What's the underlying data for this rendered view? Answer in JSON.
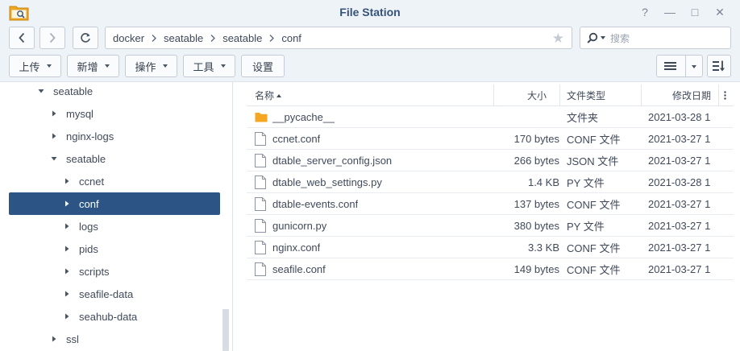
{
  "window": {
    "title": "File Station",
    "help": "?",
    "minimize": "—",
    "maximize": "□",
    "close": "✕"
  },
  "nav": {
    "breadcrumbs": [
      "docker",
      "seatable",
      "seatable",
      "conf"
    ],
    "search_placeholder": "搜索"
  },
  "toolbar": {
    "upload": "上传",
    "create": "新增",
    "action": "操作",
    "tools": "工具",
    "settings": "设置"
  },
  "sidebar": {
    "items": [
      {
        "label": "seatable",
        "expanded": true
      },
      {
        "label": "mysql",
        "expanded": false
      },
      {
        "label": "nginx-logs",
        "expanded": false
      },
      {
        "label": "seatable",
        "expanded": true
      },
      {
        "label": "ccnet",
        "expanded": false
      },
      {
        "label": "conf",
        "expanded": false,
        "selected": true
      },
      {
        "label": "logs",
        "expanded": false
      },
      {
        "label": "pids",
        "expanded": false
      },
      {
        "label": "scripts",
        "expanded": false
      },
      {
        "label": "seafile-data",
        "expanded": false
      },
      {
        "label": "seahub-data",
        "expanded": false
      },
      {
        "label": "ssl",
        "expanded": false
      }
    ]
  },
  "file_list": {
    "columns": {
      "name": "名称",
      "size": "大小",
      "type": "文件类型",
      "modified": "修改日期"
    },
    "rows": [
      {
        "name": "__pycache__",
        "size": "",
        "type": "文件夹",
        "modified": "2021-03-28 1",
        "kind": "folder"
      },
      {
        "name": "ccnet.conf",
        "size": "170 bytes",
        "type": "CONF 文件",
        "modified": "2021-03-27 1",
        "kind": "file"
      },
      {
        "name": "dtable_server_config.json",
        "size": "266 bytes",
        "type": "JSON 文件",
        "modified": "2021-03-27 1",
        "kind": "file"
      },
      {
        "name": "dtable_web_settings.py",
        "size": "1.4 KB",
        "type": "PY 文件",
        "modified": "2021-03-28 1",
        "kind": "file"
      },
      {
        "name": "dtable-events.conf",
        "size": "137 bytes",
        "type": "CONF 文件",
        "modified": "2021-03-27 1",
        "kind": "file"
      },
      {
        "name": "gunicorn.py",
        "size": "380 bytes",
        "type": "PY 文件",
        "modified": "2021-03-27 1",
        "kind": "file"
      },
      {
        "name": "nginx.conf",
        "size": "3.3 KB",
        "type": "CONF 文件",
        "modified": "2021-03-27 1",
        "kind": "file"
      },
      {
        "name": "seafile.conf",
        "size": "149 bytes",
        "type": "CONF 文件",
        "modified": "2021-03-27 1",
        "kind": "file"
      }
    ]
  },
  "colors": {
    "accent": "#2c5585",
    "title": "#36527a",
    "folder": "#f5a623",
    "chrome_bg": "#eef3f8"
  }
}
